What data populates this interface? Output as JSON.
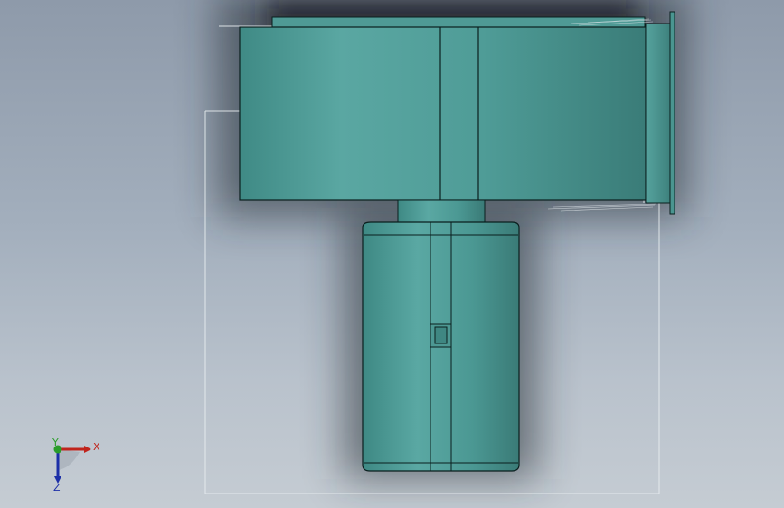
{
  "viewport": {
    "background_top": "#8e9aaa",
    "background_bottom": "#c5ccd3"
  },
  "model": {
    "body_color": "#4e9a95",
    "body_highlight": "#5fa9a4",
    "body_shade": "#3a7f7b",
    "edge_color": "#0a1f1e",
    "sketch_line_color": "#e6ecef"
  },
  "triad": {
    "x_label": "X",
    "y_label": "Y",
    "z_label": "Z",
    "x_color": "#c0241c",
    "y_color": "#2a9d2a",
    "z_color": "#1c2fa8"
  }
}
